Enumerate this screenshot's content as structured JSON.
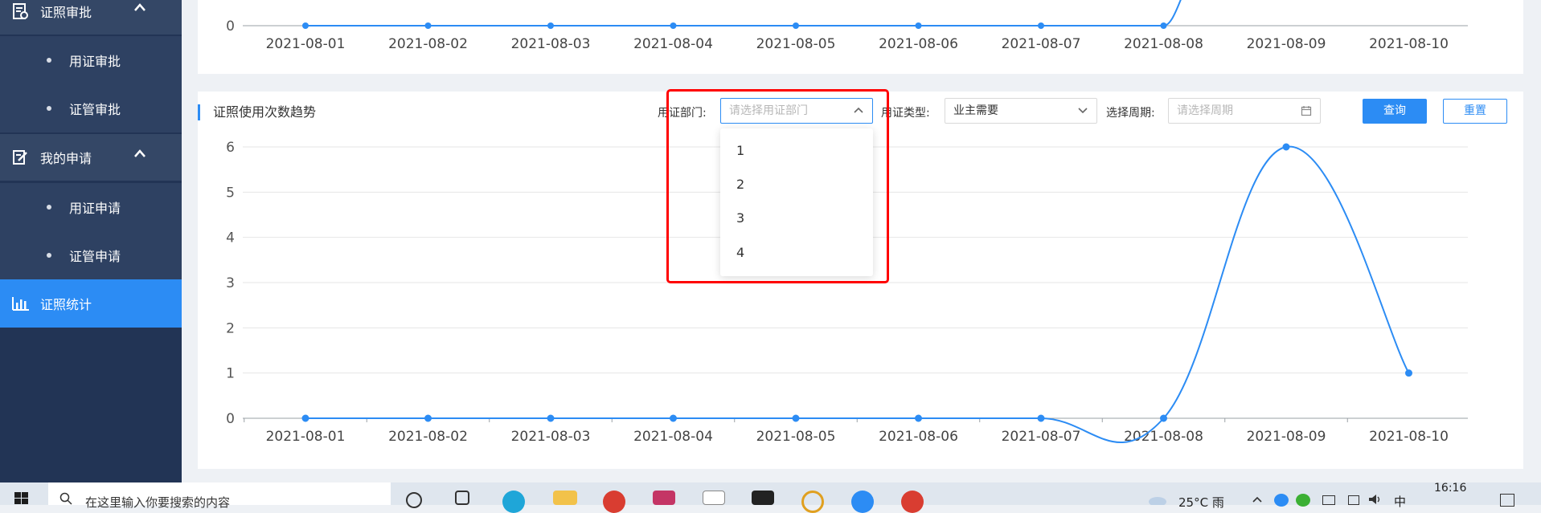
{
  "sidebar": {
    "items": [
      {
        "label": "证照审批",
        "type": "group",
        "icon": "document-check-icon",
        "expanded": true
      },
      {
        "label": "用证审批",
        "type": "sub"
      },
      {
        "label": "证管审批",
        "type": "sub"
      },
      {
        "label": "我的申请",
        "type": "group",
        "icon": "edit-document-icon",
        "expanded": true
      },
      {
        "label": "用证申请",
        "type": "sub"
      },
      {
        "label": "证管申请",
        "type": "sub"
      },
      {
        "label": "证照统计",
        "type": "active",
        "icon": "bar-chart-icon"
      }
    ]
  },
  "main": {
    "title": "证照使用次数趋势",
    "filters": {
      "dept_label": "用证部门:",
      "dept_placeholder": "请选择用证部门",
      "type_label": "用证类型:",
      "type_value": "业主需要",
      "period_label": "选择周期:",
      "period_placeholder": "请选择周期"
    },
    "query_button": "查询",
    "reset_button": "重置",
    "dept_options": [
      "1",
      "2",
      "3",
      "4"
    ]
  },
  "colors": {
    "accent": "#2c8cf4",
    "sidebar": "#223455",
    "highlight_box": "#ff0000"
  },
  "chart_data": [
    {
      "type": "line",
      "x": [
        "2021-08-01",
        "2021-08-02",
        "2021-08-03",
        "2021-08-04",
        "2021-08-05",
        "2021-08-06",
        "2021-08-07",
        "2021-08-08",
        "2021-08-09",
        "2021-08-10"
      ],
      "y_tick_visible": [
        "0"
      ],
      "note_values_partial": "chart cropped at top; values rise after 2021-08-08",
      "values": [
        0,
        0,
        0,
        0,
        0,
        0,
        0,
        0,
        null,
        null
      ]
    },
    {
      "type": "line",
      "x": [
        "2021-08-01",
        "2021-08-02",
        "2021-08-03",
        "2021-08-04",
        "2021-08-05",
        "2021-08-06",
        "2021-08-07",
        "2021-08-08",
        "2021-08-09",
        "2021-08-10"
      ],
      "values": [
        0,
        0,
        0,
        0,
        0,
        0,
        0,
        0,
        6,
        1
      ],
      "y_ticks": [
        "0",
        "1",
        "2",
        "3",
        "4",
        "5",
        "6"
      ],
      "ylim": [
        0,
        6
      ],
      "smooth": true,
      "grid": true
    }
  ],
  "taskbar": {
    "search_placeholder": "在这里输入你要搜索的内容",
    "weather": "25°C 雨",
    "ime": "中",
    "time": "16:16"
  }
}
